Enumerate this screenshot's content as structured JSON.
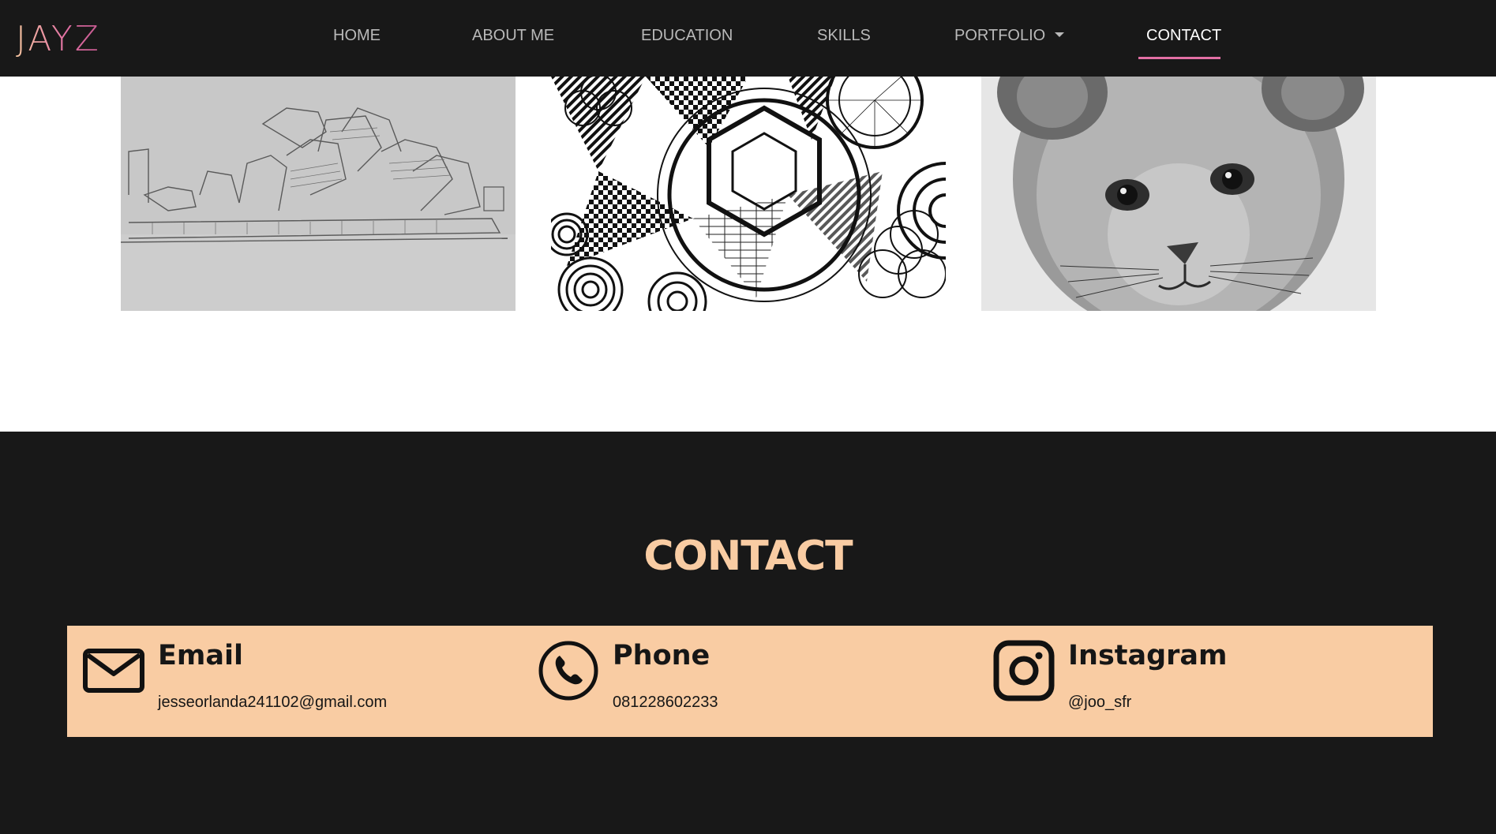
{
  "brand": {
    "logo_text": "JAYZ"
  },
  "nav": {
    "items": [
      {
        "label": "HOME"
      },
      {
        "label": "ABOUT ME"
      },
      {
        "label": "EDUCATION"
      },
      {
        "label": "SKILLS"
      },
      {
        "label": "PORTFOLIO"
      },
      {
        "label": "CONTACT"
      }
    ],
    "active": "CONTACT"
  },
  "gallery": [
    {
      "subject": "pencil sketch of modern building"
    },
    {
      "subject": "black and white zentangle pattern"
    },
    {
      "subject": "pencil drawing of lion cub"
    }
  ],
  "contact": {
    "title": "CONTACT",
    "cards": [
      {
        "icon": "envelope-icon",
        "title": "Email",
        "value": "jesseorlanda241102@gmail.com"
      },
      {
        "icon": "phone-icon",
        "title": "Phone",
        "value": "081228602233"
      },
      {
        "icon": "instagram-icon",
        "title": "Instagram",
        "value": "@joo_sfr"
      }
    ]
  },
  "colors": {
    "navbar_bg": "#181818",
    "accent_pink": "#e26fa4",
    "contact_title": "#f9cca3",
    "contact_band": "#f9cca3",
    "section_bg": "#181818"
  }
}
